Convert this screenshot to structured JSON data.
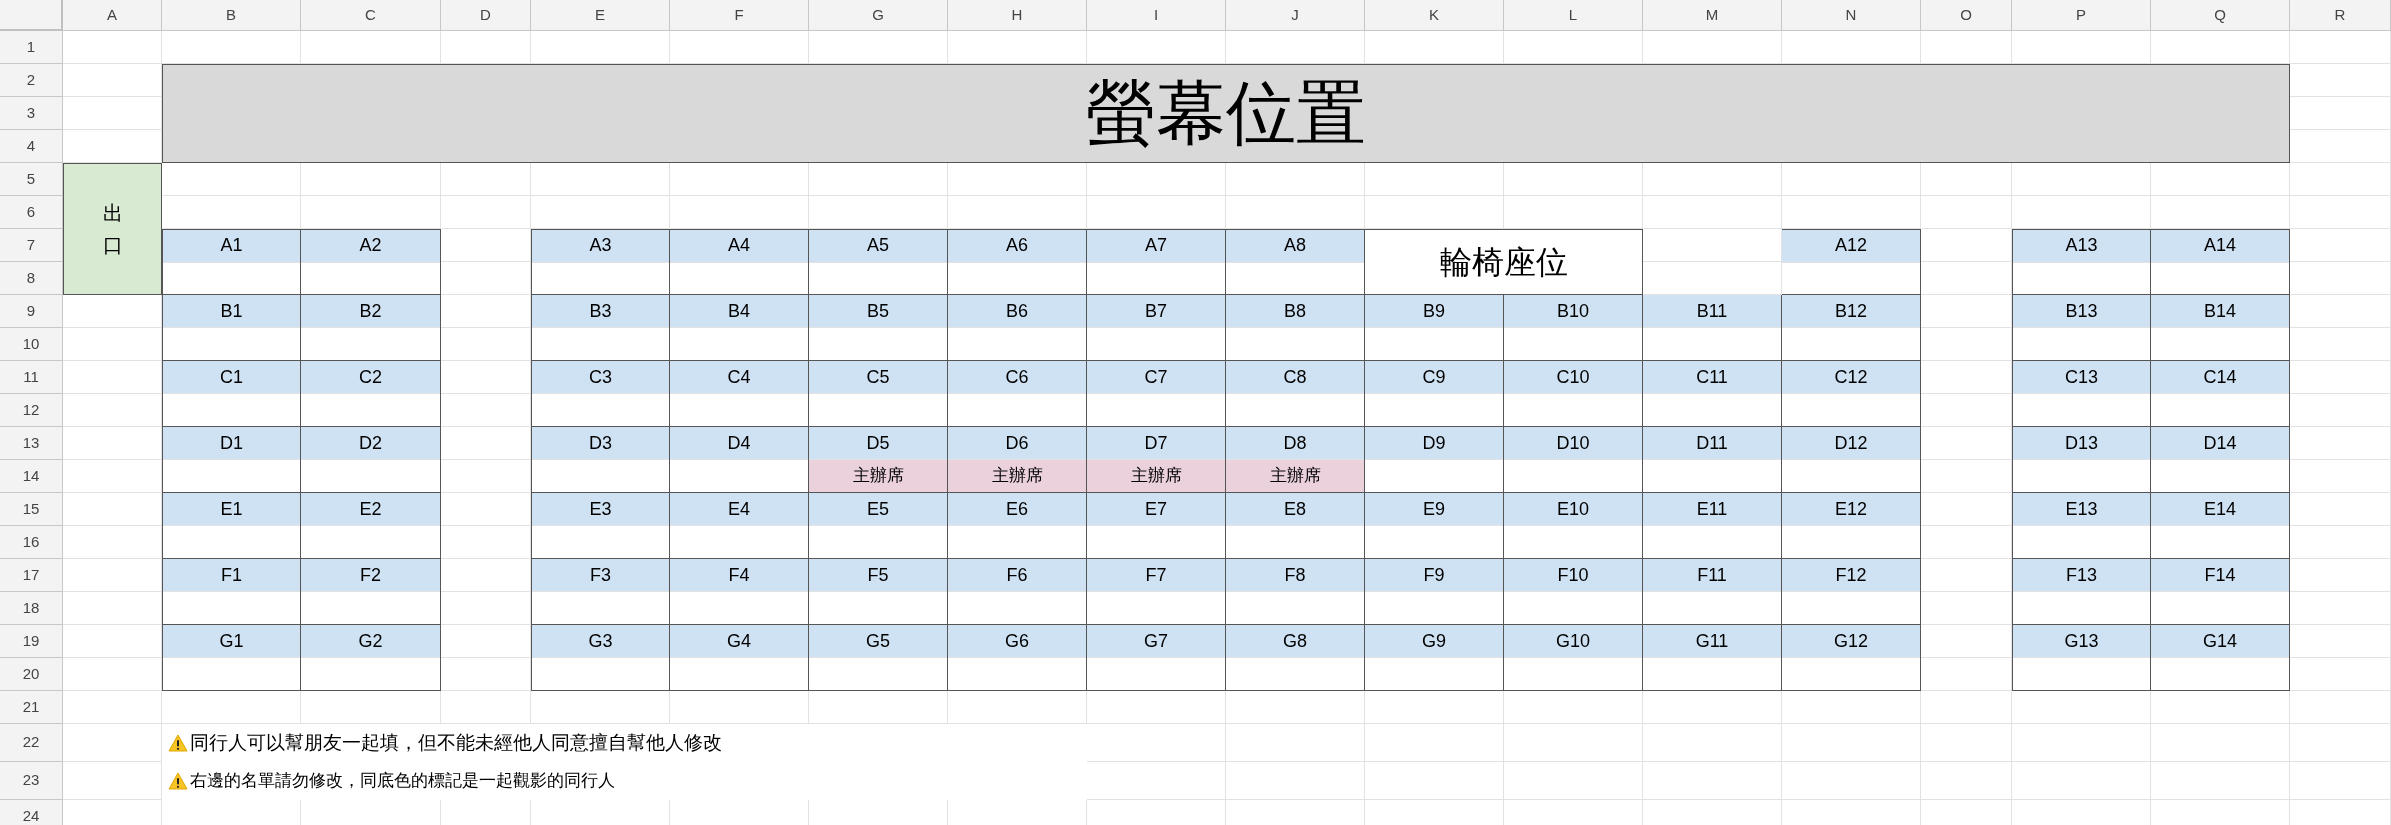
{
  "columns": [
    "A",
    "B",
    "C",
    "D",
    "E",
    "F",
    "G",
    "H",
    "I",
    "J",
    "K",
    "L",
    "M",
    "N",
    "O",
    "P",
    "Q",
    "R"
  ],
  "row_numbers": [
    "1",
    "2",
    "3",
    "4",
    "5",
    "6",
    "7",
    "8",
    "9",
    "10",
    "11",
    "12",
    "13",
    "14",
    "15",
    "16",
    "17",
    "18",
    "19",
    "20",
    "21",
    "22",
    "23",
    "24"
  ],
  "title": "螢幕位置",
  "exit_label": "出口",
  "seat_rows": [
    {
      "left": [
        {
          "kind": "seat",
          "label": "A1"
        },
        {
          "kind": "seat",
          "label": "A2"
        }
      ],
      "center": [
        {
          "kind": "seat",
          "label": "A3"
        },
        {
          "kind": "seat",
          "label": "A4"
        },
        {
          "kind": "seat",
          "label": "A5"
        },
        {
          "kind": "seat",
          "label": "A6"
        },
        {
          "kind": "seat",
          "label": "A7"
        },
        {
          "kind": "seat",
          "label": "A8"
        },
        {
          "kind": "wheelchair",
          "label": "輪椅座位"
        },
        {
          "kind": "empty"
        },
        {
          "kind": "seat",
          "label": "A12"
        }
      ],
      "right": [
        {
          "kind": "seat",
          "label": "A13"
        },
        {
          "kind": "seat",
          "label": "A14"
        }
      ]
    },
    {
      "left": [
        {
          "kind": "seat",
          "label": "B1"
        },
        {
          "kind": "seat",
          "label": "B2"
        }
      ],
      "center": [
        {
          "kind": "seat",
          "label": "B3"
        },
        {
          "kind": "seat",
          "label": "B4"
        },
        {
          "kind": "seat",
          "label": "B5"
        },
        {
          "kind": "seat",
          "label": "B6"
        },
        {
          "kind": "seat",
          "label": "B7"
        },
        {
          "kind": "seat",
          "label": "B8"
        },
        {
          "kind": "seat",
          "label": "B9"
        },
        {
          "kind": "seat",
          "label": "B10"
        },
        {
          "kind": "seat",
          "label": "B11"
        },
        {
          "kind": "seat",
          "label": "B12"
        }
      ],
      "right": [
        {
          "kind": "seat",
          "label": "B13"
        },
        {
          "kind": "seat",
          "label": "B14"
        }
      ]
    },
    {
      "left": [
        {
          "kind": "seat",
          "label": "C1"
        },
        {
          "kind": "seat",
          "label": "C2"
        }
      ],
      "center": [
        {
          "kind": "seat",
          "label": "C3"
        },
        {
          "kind": "seat",
          "label": "C4"
        },
        {
          "kind": "seat",
          "label": "C5"
        },
        {
          "kind": "seat",
          "label": "C6"
        },
        {
          "kind": "seat",
          "label": "C7"
        },
        {
          "kind": "seat",
          "label": "C8"
        },
        {
          "kind": "seat",
          "label": "C9"
        },
        {
          "kind": "seat",
          "label": "C10"
        },
        {
          "kind": "seat",
          "label": "C11"
        },
        {
          "kind": "seat",
          "label": "C12"
        }
      ],
      "right": [
        {
          "kind": "seat",
          "label": "C13"
        },
        {
          "kind": "seat",
          "label": "C14"
        }
      ]
    },
    {
      "left": [
        {
          "kind": "seat",
          "label": "D1"
        },
        {
          "kind": "seat",
          "label": "D2"
        }
      ],
      "center": [
        {
          "kind": "seat",
          "label": "D3"
        },
        {
          "kind": "seat",
          "label": "D4"
        },
        {
          "kind": "seat",
          "label": "D5",
          "host_label": "主辦席"
        },
        {
          "kind": "seat",
          "label": "D6",
          "host_label": "主辦席"
        },
        {
          "kind": "seat",
          "label": "D7",
          "host_label": "主辦席"
        },
        {
          "kind": "seat",
          "label": "D8",
          "host_label": "主辦席"
        },
        {
          "kind": "seat",
          "label": "D9"
        },
        {
          "kind": "seat",
          "label": "D10"
        },
        {
          "kind": "seat",
          "label": "D11"
        },
        {
          "kind": "seat",
          "label": "D12"
        }
      ],
      "right": [
        {
          "kind": "seat",
          "label": "D13"
        },
        {
          "kind": "seat",
          "label": "D14"
        }
      ]
    },
    {
      "left": [
        {
          "kind": "seat",
          "label": "E1"
        },
        {
          "kind": "seat",
          "label": "E2"
        }
      ],
      "center": [
        {
          "kind": "seat",
          "label": "E3"
        },
        {
          "kind": "seat",
          "label": "E4"
        },
        {
          "kind": "seat",
          "label": "E5"
        },
        {
          "kind": "seat",
          "label": "E6"
        },
        {
          "kind": "seat",
          "label": "E7"
        },
        {
          "kind": "seat",
          "label": "E8"
        },
        {
          "kind": "seat",
          "label": "E9"
        },
        {
          "kind": "seat",
          "label": "E10"
        },
        {
          "kind": "seat",
          "label": "E11"
        },
        {
          "kind": "seat",
          "label": "E12"
        }
      ],
      "right": [
        {
          "kind": "seat",
          "label": "E13"
        },
        {
          "kind": "seat",
          "label": "E14"
        }
      ]
    },
    {
      "left": [
        {
          "kind": "seat",
          "label": "F1"
        },
        {
          "kind": "seat",
          "label": "F2"
        }
      ],
      "center": [
        {
          "kind": "seat",
          "label": "F3"
        },
        {
          "kind": "seat",
          "label": "F4"
        },
        {
          "kind": "seat",
          "label": "F5"
        },
        {
          "kind": "seat",
          "label": "F6"
        },
        {
          "kind": "seat",
          "label": "F7"
        },
        {
          "kind": "seat",
          "label": "F8"
        },
        {
          "kind": "seat",
          "label": "F9"
        },
        {
          "kind": "seat",
          "label": "F10"
        },
        {
          "kind": "seat",
          "label": "F11"
        },
        {
          "kind": "seat",
          "label": "F12"
        }
      ],
      "right": [
        {
          "kind": "seat",
          "label": "F13"
        },
        {
          "kind": "seat",
          "label": "F14"
        }
      ]
    },
    {
      "left": [
        {
          "kind": "seat",
          "label": "G1"
        },
        {
          "kind": "seat",
          "label": "G2"
        }
      ],
      "center": [
        {
          "kind": "seat",
          "label": "G3"
        },
        {
          "kind": "seat",
          "label": "G4"
        },
        {
          "kind": "seat",
          "label": "G5"
        },
        {
          "kind": "seat",
          "label": "G6"
        },
        {
          "kind": "seat",
          "label": "G7"
        },
        {
          "kind": "seat",
          "label": "G8"
        },
        {
          "kind": "seat",
          "label": "G9"
        },
        {
          "kind": "seat",
          "label": "G10"
        },
        {
          "kind": "seat",
          "label": "G11"
        },
        {
          "kind": "seat",
          "label": "G12"
        }
      ],
      "right": [
        {
          "kind": "seat",
          "label": "G13"
        },
        {
          "kind": "seat",
          "label": "G14"
        }
      ]
    }
  ],
  "notes": [
    "同行人可以幫朋友一起填，但不能未經他人同意擅自幫他人修改",
    "右邊的名單請勿修改，同底色的標記是一起觀影的同行人"
  ]
}
